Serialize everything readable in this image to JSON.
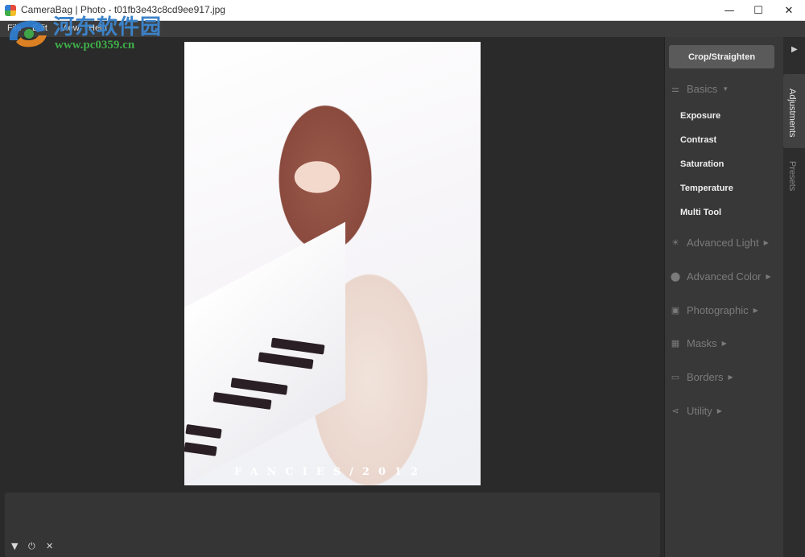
{
  "window": {
    "title": "CameraBag | Photo - t01fb3e43c8cd9ee917.jpg",
    "min_glyph": "—",
    "max_glyph": "☐",
    "close_glyph": "✕"
  },
  "menu": [
    "File",
    "Edit",
    "View",
    "Help"
  ],
  "watermark": {
    "site": "河东软件园",
    "url": "www.pc0359.cn"
  },
  "photo": {
    "caption": "FANCIES/2012"
  },
  "filmstrip": {
    "toggle_glyph": "▼",
    "power_glyph": "⏻",
    "close_glyph": "✕"
  },
  "panel": {
    "crop_button": "Crop/Straighten",
    "sections": {
      "basics": {
        "label": "Basics",
        "icon": "sliders-icon",
        "arrow": "▼"
      },
      "advanced_light": {
        "label": "Advanced Light",
        "icon": "sun-icon",
        "arrow": "▶"
      },
      "advanced_color": {
        "label": "Advanced Color",
        "icon": "color-circles-icon",
        "arrow": "▶"
      },
      "photographic": {
        "label": "Photographic",
        "icon": "camera-icon",
        "arrow": "▶"
      },
      "masks": {
        "label": "Masks",
        "icon": "checker-mask-icon",
        "arrow": "▶"
      },
      "borders": {
        "label": "Borders",
        "icon": "frame-icon",
        "arrow": "▶"
      },
      "utility": {
        "label": "Utility",
        "icon": "share-node-icon",
        "arrow": "▶"
      }
    },
    "basics_items": [
      "Exposure",
      "Contrast",
      "Saturation",
      "Temperature",
      "Multi Tool"
    ]
  },
  "tabs": {
    "collapse_glyph": "▶",
    "adjustments": "Adjustments",
    "presets": "Presets"
  }
}
